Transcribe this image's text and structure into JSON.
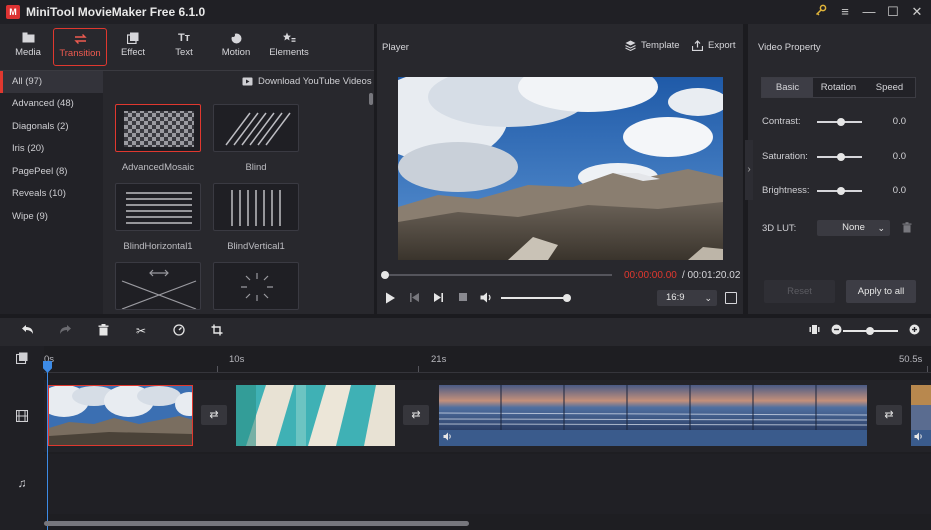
{
  "app": {
    "title": "MiniTool MovieMaker Free 6.1.0",
    "logo_text": "M",
    "icons": [
      "key-icon",
      "menu-icon",
      "minimize-icon",
      "maximize-icon",
      "close-icon"
    ]
  },
  "toolbar": {
    "items": [
      {
        "label": "Media",
        "icon": "media-icon"
      },
      {
        "label": "Transition",
        "icon": "transition-icon",
        "active": true
      },
      {
        "label": "Effect",
        "icon": "effect-icon"
      },
      {
        "label": "Text",
        "icon": "text-icon",
        "glyph": "Tт"
      },
      {
        "label": "Motion",
        "icon": "motion-icon"
      },
      {
        "label": "Elements",
        "icon": "elements-icon"
      }
    ]
  },
  "categories": [
    {
      "label": "All (97)",
      "active": true
    },
    {
      "label": "Advanced (48)"
    },
    {
      "label": "Diagonals (2)"
    },
    {
      "label": "Iris (20)"
    },
    {
      "label": "PagePeel (8)"
    },
    {
      "label": "Reveals (10)"
    },
    {
      "label": "Wipe (9)"
    }
  ],
  "download_link": "Download YouTube Videos",
  "transitions": [
    {
      "label": "AdvancedMosaic",
      "selected": true
    },
    {
      "label": "Blind"
    },
    {
      "label": "BlindHorizontal1"
    },
    {
      "label": "BlindVertical1"
    },
    {
      "label": ""
    },
    {
      "label": ""
    }
  ],
  "player": {
    "label": "Player",
    "template": "Template",
    "export": "Export",
    "time_current": "00:00:00.00",
    "time_total": " / 00:01:20.02",
    "aspect": "16:9",
    "progress": 0.0,
    "volume": 1.0
  },
  "property": {
    "title": "Video Property",
    "tabs": [
      {
        "label": "Basic",
        "active": true
      },
      {
        "label": "Rotation"
      },
      {
        "label": "Speed"
      }
    ],
    "rows": [
      {
        "label": "Contrast:",
        "value": "0.0"
      },
      {
        "label": "Saturation:",
        "value": "0.0"
      },
      {
        "label": "Brightness:",
        "value": "0.0"
      }
    ],
    "lut_label": "3D LUT:",
    "lut_value": "None",
    "reset": "Reset",
    "apply_all": "Apply to all"
  },
  "timeline": {
    "ruler": [
      "0s",
      "10s",
      "21s",
      "50.5s"
    ],
    "zoom": 0.5
  },
  "colors": {
    "accent": "#e0382f",
    "playhead": "#3d8be6",
    "audio": "#3a5b8c"
  }
}
